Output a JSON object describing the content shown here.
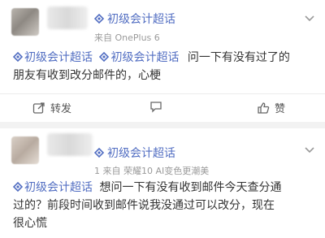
{
  "posts": [
    {
      "topic": "初级会计超话",
      "source": "来自 OnePlus 6",
      "tags": [
        "初级会计超话",
        "初级会计超话"
      ],
      "body_line1": "问一下有没有过了的",
      "body_line2": "朋友有收到改分邮件的，心梗",
      "actions": {
        "repost": "转发",
        "comment_icon": "comment-icon",
        "like": "赞"
      }
    },
    {
      "topic": "初级会计超话",
      "source": "1 来自 荣耀10 AI变色更潮美",
      "tags": [
        "初级会计超话"
      ],
      "body_line1": "想问一下有没有收到邮件今天查分通",
      "body_line2": "过的？前段时间收到邮件说我没通过可以改分，现在",
      "body_line3": "很心慌"
    }
  ],
  "colors": {
    "link": "#526ec2",
    "bg": "#f2f2f2"
  }
}
